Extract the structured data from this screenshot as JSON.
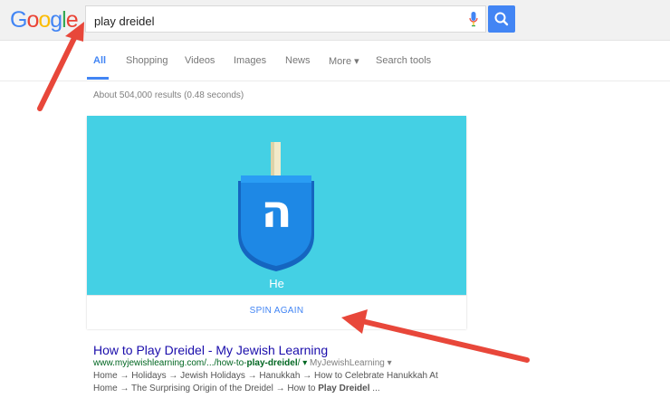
{
  "logo": {
    "letters": [
      "G",
      "o",
      "o",
      "g",
      "l",
      "e"
    ],
    "colors": [
      "#4285f4",
      "#ea4335",
      "#fbbc05",
      "#4285f4",
      "#34a853",
      "#ea4335"
    ]
  },
  "search": {
    "query": "play dreidel",
    "mic_icon": "microphone-icon",
    "button_icon": "search-icon"
  },
  "tabs": [
    {
      "label": "All",
      "active": true
    },
    {
      "label": "Shopping"
    },
    {
      "label": "Videos"
    },
    {
      "label": "Images"
    },
    {
      "label": "News"
    },
    {
      "label": "More ▾"
    },
    {
      "label": "Search tools"
    }
  ],
  "result_stats": "About 504,000 results (0.48 seconds)",
  "dreidel": {
    "letter": "ה",
    "side_name": "He",
    "spin_label": "SPIN AGAIN",
    "colors": {
      "background": "#44d0e4",
      "body": "#1e88e5",
      "handle": "#f2eac9"
    }
  },
  "result": {
    "title": "How to Play Dreidel - My Jewish Learning",
    "url_prefix": "www.myjewishlearning.com/.../how-to-",
    "url_bold": "play-dreidel",
    "url_suffix": "/",
    "url_caret": "▾",
    "source": "MyJewishLearning",
    "source_caret": "▾",
    "snippet_line1": "Home → Holidays → Jewish Holidays → Hanukkah → How to Celebrate Hanukkah At",
    "snippet_line2_prefix": "Home → The Surprising Origin of the Dreidel → How to ",
    "snippet_line2_bold": "Play Dreidel",
    "snippet_line2_suffix": " ..."
  },
  "annotation_color": "#e8473a"
}
